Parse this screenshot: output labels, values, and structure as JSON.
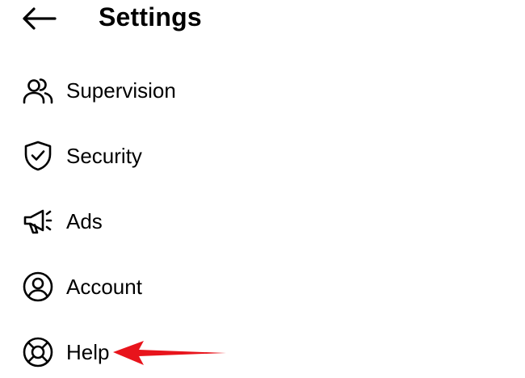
{
  "header": {
    "back_icon": "arrow-left-icon",
    "title": "Settings"
  },
  "menu": {
    "items": [
      {
        "label": "Supervision",
        "icon": "people-icon"
      },
      {
        "label": "Security",
        "icon": "shield-check-icon"
      },
      {
        "label": "Ads",
        "icon": "megaphone-icon"
      },
      {
        "label": "Account",
        "icon": "user-circle-icon"
      },
      {
        "label": "Help",
        "icon": "lifebuoy-icon"
      }
    ]
  },
  "annotation": {
    "icon": "red-arrow-icon",
    "color": "#e8141c"
  },
  "colors": {
    "text": "#000000",
    "background": "#ffffff",
    "annotation": "#e8141c"
  }
}
